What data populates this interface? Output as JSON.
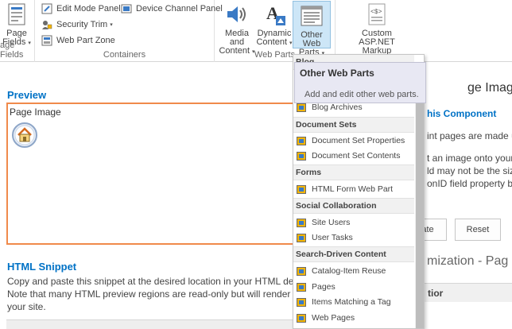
{
  "ribbon": {
    "groups": {
      "page_fields_partial": "age Fields",
      "containers": "Containers",
      "web_parts": "Web Parts"
    },
    "page_fields_btn": {
      "line1": "Page",
      "line2": "Fields"
    },
    "edit_mode_panel": "Edit Mode Panel",
    "security_trim": "Security Trim",
    "web_part_zone": "Web Part Zone",
    "device_channel_panel": "Device Channel Panel",
    "media_content": {
      "line1": "Media and",
      "line2": "Content"
    },
    "dynamic_content": {
      "line1": "Dynamic",
      "line2": "Content"
    },
    "other_web_parts": {
      "line1": "Other Web",
      "line2": "Parts"
    },
    "custom_aspnet": {
      "line1": "Custom ASP.NET",
      "line2": "Markup"
    }
  },
  "main": {
    "preview_heading": "Preview",
    "preview_text": "Page Image",
    "html_snippet_heading": "HTML Snippet",
    "snippet_lines": [
      "Copy and paste this snippet at the desired location in your HTML desig",
      "Note that many HTML preview regions are read-only but will render pro",
      "your site."
    ]
  },
  "right_partial": {
    "title": "ge Imag",
    "about": "his Component",
    "line1": "int pages are made u",
    "line2": "t an image onto your",
    "line3": "ld may not be the siz",
    "line4": "onID field property b",
    "update_btn": "ate",
    "reset_btn": "Reset",
    "customization": "mization - Pag",
    "tior": "tior"
  },
  "dropdown": {
    "header": "Blog",
    "categories": {
      "document_sets": "Document Sets",
      "forms": "Forms",
      "social": "Social Collaboration",
      "search": "Search-Driven Content"
    },
    "items": {
      "blog_archives": "Blog Archives",
      "docset_properties": "Document Set Properties",
      "docset_contents": "Document Set Contents",
      "html_form": "HTML Form Web Part",
      "site_users": "Site Users",
      "user_tasks": "User Tasks",
      "catalog_item_reuse": "Catalog-Item Reuse",
      "pages": "Pages",
      "items_matching_tag": "Items Matching a Tag",
      "web_pages": "Web Pages"
    }
  },
  "tooltip": {
    "title": "Other Web Parts",
    "description": "Add and edit other web parts."
  },
  "colors": {
    "accent": "#0072c6",
    "preview_border": "#f08a4b",
    "selected_bg": "#cde6f7",
    "tooltip_bg": "#e8e8f3"
  },
  "icons": [
    "page-fields-icon",
    "edit-mode-panel-icon",
    "security-trim-icon",
    "web-part-zone-icon",
    "device-channel-panel-icon",
    "media-content-icon",
    "dynamic-content-icon",
    "other-web-parts-icon",
    "custom-aspnet-icon",
    "home-image-icon",
    "web-part-icon"
  ]
}
